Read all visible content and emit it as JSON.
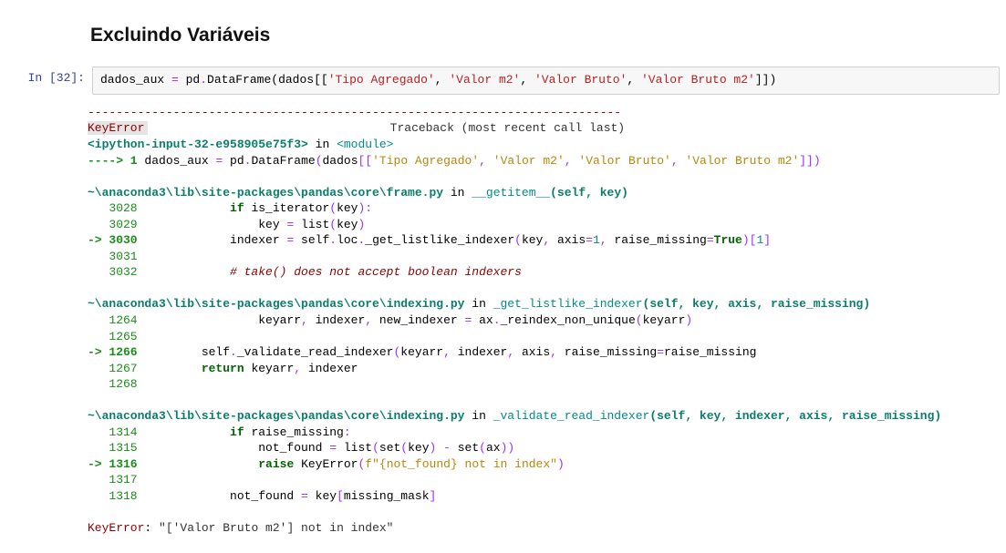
{
  "markdown": {
    "heading": "Excluindo Variáveis"
  },
  "prompt": {
    "in_label": "In [32]:"
  },
  "code": {
    "var": "dados_aux",
    "eq": " = ",
    "pd": "pd",
    "dot1": ".",
    "DataFrame": "DataFrame",
    "lpar": "(",
    "dados": "dados",
    "lbr": "[[",
    "s1": "'Tipo Agregado'",
    "c1": ", ",
    "s2": "'Valor m2'",
    "c2": ", ",
    "s3": "'Valor Bruto'",
    "c3": ", ",
    "s4": "'Valor Bruto m2'",
    "rbr": "]]",
    "rpar": ")"
  },
  "tb": {
    "dashline": "---------------------------------------------------------------------------",
    "err_name": "KeyError",
    "trace_hdr": "                                  Traceback (most recent call last)",
    "frame0_a": "<ipython-input-32-e958905e75f3>",
    "frame0_in": " in ",
    "frame0_mod": "<module>",
    "frame0_arrow": "----> 1",
    "frame0_body_a": " dados_aux ",
    "frame0_op1": "=",
    "frame0_body_b": " pd",
    "frame0_op2": ".",
    "frame0_body_c": "DataFrame",
    "frame0_lp": "(",
    "frame0_body_d": "dados",
    "frame0_lbr": "[[",
    "frame0_s1": "'Tipo Agregado'",
    "frame0_c": ", ",
    "frame0_s2": "'Valor m2'",
    "frame0_s3": "'Valor Bruto'",
    "frame0_s4": "'Valor Bruto m2'",
    "frame0_rbr": "]]",
    "frame0_rp": ")",
    "frame1_path": "~\\anaconda3\\lib\\site-packages\\pandas\\core\\frame.py",
    "frame1_in": " in ",
    "frame1_func": "__getitem__",
    "frame1_sig": "(self, key)",
    "l3028n": "   3028",
    "l3028_if": "if",
    "l3028_body": " is_iterator",
    "l3028_lp": "(",
    "l3028_key": "key",
    "l3028_rp": ")",
    "l3028_colon": ":",
    "l3029n": "   3029",
    "l3029_body1": "                 key ",
    "l3029_eq": "=",
    "l3029_body2": " list",
    "l3029_lp": "(",
    "l3029_key": "key",
    "l3029_rp": ")",
    "l3030arrow": "-> 3030",
    "l3030_body1": "             indexer ",
    "l3030_eq": "=",
    "l3030_body2": " self",
    "l3030_dot": ".",
    "l3030_loc": "loc",
    "l3030_dot2": ".",
    "l3030_fn": "_get_listlike_indexer",
    "l3030_lp": "(",
    "l3030_args": "key",
    "l3030_c1": ", ",
    "l3030_axis": "axis",
    "l3030_eq2": "=",
    "l3030_one": "1",
    "l3030_c2": ", ",
    "l3030_rm": "raise_missing",
    "l3030_eq3": "=",
    "l3030_true": "True",
    "l3030_rp": ")",
    "l3030_idx": "[",
    "l3030_one2": "1",
    "l3030_idx2": "]",
    "l3031n": "   3031",
    "l3032n": "   3032",
    "l3032_cmt": "# take() does not accept boolean indexers",
    "frame2_path": "~\\anaconda3\\lib\\site-packages\\pandas\\core\\indexing.py",
    "frame2_in": " in ",
    "frame2_func": "_get_listlike_indexer",
    "frame2_sig": "(self, key, axis, raise_missing)",
    "l1264n": "   1264",
    "l1264_body1": "                 keyarr",
    "l1264_c1": ", ",
    "l1264_body2": "indexer",
    "l1264_c2": ", ",
    "l1264_body3": "new_indexer ",
    "l1264_eq": "=",
    "l1264_body4": " ax",
    "l1264_dot": ".",
    "l1264_fn": "_reindex_non_unique",
    "l1264_lp": "(",
    "l1264_arg": "keyarr",
    "l1264_rp": ")",
    "l1265n": "   1265",
    "l1266arrow": "-> 1266",
    "l1266_body1": "         self",
    "l1266_dot": ".",
    "l1266_fn": "_validate_read_indexer",
    "l1266_lp": "(",
    "l1266_a1": "keyarr",
    "l1266_c": ", ",
    "l1266_a2": "indexer",
    "l1266_a3": "axis",
    "l1266_rm": "raise_missing",
    "l1266_eq": "=",
    "l1266_rm2": "raise_missing",
    "l1266_rp": ")",
    "l1267n": "   1267",
    "l1267_ret": "return",
    "l1267_body": " keyarr",
    "l1267_c": ", ",
    "l1267_body2": "indexer",
    "l1268n": "   1268",
    "frame3_path": "~\\anaconda3\\lib\\site-packages\\pandas\\core\\indexing.py",
    "frame3_in": " in ",
    "frame3_func": "_validate_read_indexer",
    "frame3_sig": "(self, key, indexer, axis, raise_missing)",
    "l1314n": "   1314",
    "l1314_if": "if",
    "l1314_body": " raise_missing",
    "l1314_colon": ":",
    "l1315n": "   1315",
    "l1315_body1": "                 not_found ",
    "l1315_eq": "=",
    "l1315_body2": " list",
    "l1315_lp": "(",
    "l1315_set1": "set",
    "l1315_lp2": "(",
    "l1315_key": "key",
    "l1315_rp2": ")",
    "l1315_minus": " - ",
    "l1315_set2": "set",
    "l1315_lp3": "(",
    "l1315_ax": "ax",
    "l1315_rp3": ")",
    "l1315_rp": ")",
    "l1316arrow": "-> 1316",
    "l1316_raise": "raise",
    "l1316_sp": " ",
    "l1316_ke": "KeyError",
    "l1316_lp": "(",
    "l1316_f": "f\"",
    "l1316_body": "{not_found}",
    "l1316_txt": " not in index",
    "l1316_fq": "\"",
    "l1316_rp": ")",
    "l1317n": "   1317",
    "l1318n": "   1318",
    "l1318_body1": "             not_found ",
    "l1318_eq": "=",
    "l1318_body2": " key",
    "l1318_lbr": "[",
    "l1318_mm": "missing_mask",
    "l1318_rbr": "]",
    "final_err": "KeyError",
    "final_colon": ": ",
    "final_msg": "\"['Valor Bruto m2'] not in index\""
  }
}
